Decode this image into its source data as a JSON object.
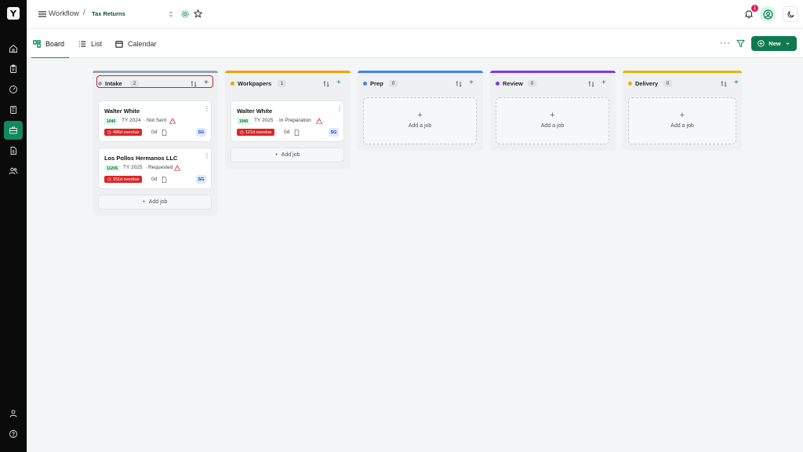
{
  "header": {
    "breadcrumb_root": "Workflow",
    "breadcrumb_sep": "/",
    "breadcrumb_current": "Tax Returns",
    "notification_count": "1"
  },
  "viewbar": {
    "tabs": [
      {
        "label": "Board",
        "active": true,
        "icon": "board-icon"
      },
      {
        "label": "List",
        "active": false,
        "icon": "list-icon"
      },
      {
        "label": "Calendar",
        "active": false,
        "icon": "calendar-icon"
      }
    ],
    "more": "···",
    "new_label": "New"
  },
  "sidebar": {
    "items": [
      "home-icon",
      "clipboard-icon",
      "gauge-icon",
      "calculator-icon",
      "briefcase-icon",
      "document-icon",
      "users-icon"
    ],
    "bottom": [
      "user-icon",
      "help-icon"
    ],
    "active_index": 4
  },
  "columns": [
    {
      "title": "Intake",
      "count": "2",
      "color": "#9ca3af",
      "cards": [
        {
          "name": "Walter White",
          "form": "1040",
          "year": "TY 2024",
          "status": "· Not Sent",
          "overdue": "486d overdue",
          "days": "0d",
          "assignee": "SG"
        },
        {
          "name": "Los Pollos Hermanos LLC",
          "form": "1120S",
          "year": "TY 2025",
          "status": "· Requested",
          "overdue": "151d overdue",
          "days": "0d",
          "assignee": "SG"
        }
      ],
      "add_job": "Add job"
    },
    {
      "title": "Workpapers",
      "count": "1",
      "color": "#f59e0b",
      "cards": [
        {
          "name": "Walter White",
          "form": "1040",
          "year": "TY 2025",
          "status": "· In Preparation",
          "overdue": "121d overdue",
          "days": "0d",
          "assignee": "SG"
        }
      ],
      "add_job": "Add job"
    },
    {
      "title": "Prep",
      "count": "0",
      "color": "#3b82f6",
      "empty_label": "Add a job"
    },
    {
      "title": "Review",
      "count": "0",
      "color": "#7c3aed",
      "empty_label": "Add a job"
    },
    {
      "title": "Delivery",
      "count": "0",
      "color": "#eab308",
      "empty_label": "Add a job"
    }
  ]
}
